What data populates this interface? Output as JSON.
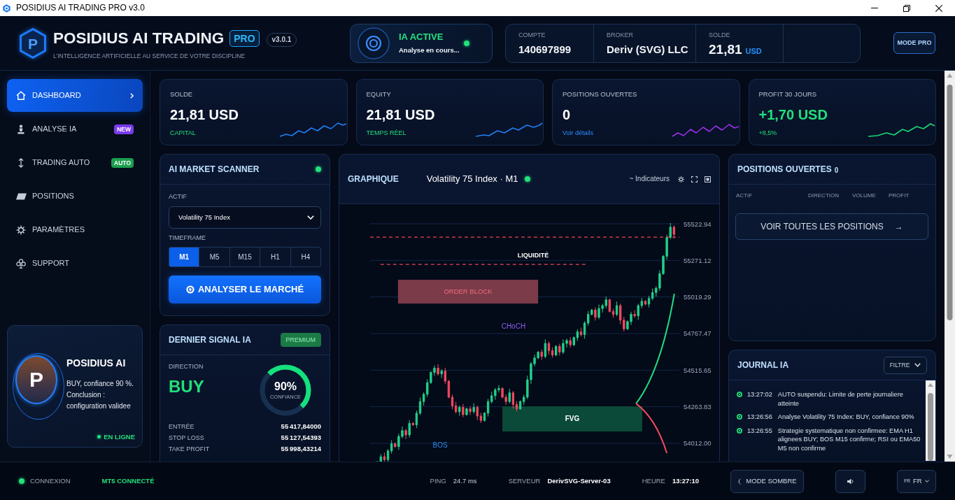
{
  "window": {
    "title": "POSIDIUS AI TRADING PRO v3.0"
  },
  "header": {
    "logo_letter": "P",
    "brand": "POSIDIUS AI TRADING",
    "edition": "PRO",
    "version": "v3.0.1",
    "tagline": "L’INTELLIGENCE ARTIFICIELLE AU SERVICE DE VOTRE DISCIPLINE",
    "ai_status": {
      "title": "IA ACTIVE",
      "subtitle": "Analyse en cours...",
      "online": true
    },
    "account": [
      {
        "label": "COMPTE",
        "value": "140697899"
      },
      {
        "label": "BROKER",
        "value": "Deriv (SVG) LLC"
      },
      {
        "label": "SOLDE",
        "value": "21,81",
        "unit": "USD"
      }
    ],
    "mode_button": "MODE PRO"
  },
  "sidebar": {
    "items": [
      {
        "label": "DASHBOARD",
        "selected": true
      },
      {
        "label": "ANALYSE IA",
        "selected": false,
        "badge": {
          "text": "NEW",
          "color": "#7c3aed"
        }
      },
      {
        "label": "TRADING AUTO",
        "selected": false,
        "badge": {
          "text": "AUTO",
          "color": "#1c9e4e"
        }
      },
      {
        "label": "POSITIONS",
        "selected": false
      },
      {
        "label": "PARAMÈTRES",
        "selected": false
      },
      {
        "label": "SUPPORT",
        "selected": false
      }
    ],
    "profile": {
      "initial": "P",
      "name": "POSIDIUS AI",
      "message": "BUY, confiance 90 %. Conclusion : configuration validee",
      "status": "EN LIGNE",
      "online": true
    }
  },
  "stats": [
    {
      "label": "SOLDE",
      "value": "21,81 USD",
      "note": "CAPITAL",
      "note_link": false,
      "positive": false,
      "color": "#1f7ef2"
    },
    {
      "label": "EQUITY",
      "value": "21,81 USD",
      "note": "TEMPS RÉEL",
      "note_link": false,
      "positive": false,
      "color": "#1f7ef2"
    },
    {
      "label": "POSITIONS OUVERTES",
      "value": "0",
      "note": "Voir détails",
      "note_link": true,
      "positive": false,
      "color": "#9b30e8"
    },
    {
      "label": "PROFIT 30 JOURS",
      "value": "+1,70 USD",
      "note": "+8,5%",
      "note_link": false,
      "positive": true,
      "color": "#19d877"
    }
  ],
  "scanner": {
    "title": "AI MARKET SCANNER",
    "live": true,
    "asset_label": "ACTIF",
    "asset": "Volatility 75 Index",
    "timeframe_label": "TIMEFRAME",
    "timeframes": [
      {
        "label": "M1",
        "selected": true
      },
      {
        "label": "M5",
        "selected": false
      },
      {
        "label": "M15",
        "selected": false
      },
      {
        "label": "H1",
        "selected": false
      },
      {
        "label": "H4",
        "selected": false
      }
    ],
    "action": "ANALYSER LE MARCHÉ"
  },
  "signal": {
    "title": "DERNIER SIGNAL IA",
    "badge": "PREMIUM",
    "direction_label": "DIRECTION",
    "direction": "BUY",
    "confidence": {
      "value": "90%",
      "label": "CONFIANCE",
      "level": 0.5
    },
    "levels": [
      {
        "label": "ENTRÉE",
        "value": "55 417,84000"
      },
      {
        "label": "STOP LOSS",
        "value": "55 127,54393"
      },
      {
        "label": "TAKE PROFIT",
        "value": "55 998,43214"
      }
    ]
  },
  "chart": {
    "title": "GRAPHIQUE",
    "symbol": "Volatility 75 Index · M1",
    "live": true,
    "indicators": "~ Indicateurs",
    "price_labels": [
      "55522.94",
      "55271.12",
      "55019.29",
      "54767.47",
      "54515.65",
      "54263.83",
      "54012.00"
    ],
    "markers": [
      {
        "kind": "liquidity",
        "text": "LIQUIDITÉ"
      },
      {
        "kind": "orderblock",
        "text": "ORDER BLOCK"
      },
      {
        "kind": "choch",
        "text": "CHoCH"
      },
      {
        "kind": "fvg",
        "text": "FVG"
      },
      {
        "kind": "bos",
        "text": "BOS"
      }
    ]
  },
  "positions": {
    "title": "POSITIONS OUVERTES",
    "count": "0",
    "columns": [
      "ACTIF",
      "DIRECTION",
      "VOLUME",
      "PROFIT"
    ],
    "action": {
      "label": "VOIR TOUTES LES POSITIONS",
      "arrow": "→"
    }
  },
  "journal": {
    "title": "JOURNAL IA",
    "filter": "FILTRE",
    "entries": [
      {
        "time": "13:27:02",
        "message": "AUTO suspendu: Limite de perte journaliere atteinte",
        "color": "#22d873"
      },
      {
        "time": "13:26:56",
        "message": "Analyse Volatility 75 Index: BUY, confiance 90%",
        "color": "#22d873"
      },
      {
        "time": "13:26:55",
        "message": "Strategie systematique non confirmee: EMA H1 alignees BUY; BOS M15 confirme; RSI ou EMA50 M5 non confirme",
        "color": "#22d873"
      }
    ]
  },
  "status_bar": {
    "connection": {
      "label": "CONNEXION",
      "value": "MT5 CONNECTÉ",
      "connected": true
    },
    "ping": {
      "label": "PING",
      "value": "24.7 ms"
    },
    "server": {
      "label": "SERVEUR",
      "value": "DerivSVG-Server-03"
    },
    "clock": {
      "label": "HEURE",
      "value": "13:27:10"
    },
    "theme_button": "MODE SOMBRE",
    "language": {
      "flag": "FR",
      "label": "FR"
    }
  }
}
